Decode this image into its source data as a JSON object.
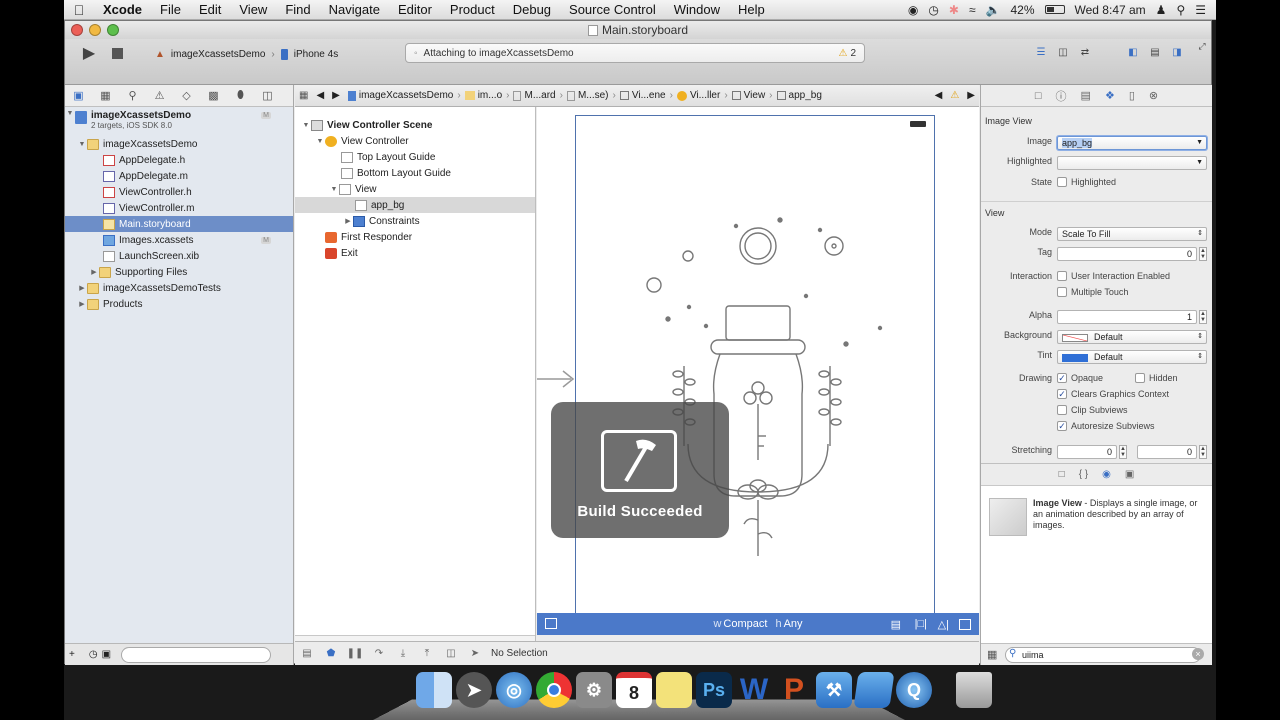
{
  "menubar": {
    "items": [
      "Xcode",
      "File",
      "Edit",
      "View",
      "Find",
      "Navigate",
      "Editor",
      "Product",
      "Debug",
      "Source Control",
      "Window",
      "Help"
    ],
    "battery": "42%",
    "clock": "Wed 8:47 am"
  },
  "window": {
    "title": "Main.storyboard",
    "scheme_target": "imageXcassetsDemo",
    "scheme_device": "iPhone 4s",
    "activity_text": "Attaching to imageXcassetsDemo",
    "warning_count": "2"
  },
  "navigator": {
    "project_name": "imageXcassetsDemo",
    "project_sub": "2 targets, iOS SDK 8.0",
    "badge": "M",
    "group": "imageXcassetsDemo",
    "files": [
      {
        "name": "AppDelegate.h"
      },
      {
        "name": "AppDelegate.m"
      },
      {
        "name": "ViewController.h"
      },
      {
        "name": "ViewController.m"
      },
      {
        "name": "Main.storyboard"
      },
      {
        "name": "Images.xcassets"
      },
      {
        "name": "LaunchScreen.xib"
      },
      {
        "name": "Supporting Files"
      }
    ],
    "tests_group": "imageXcassetsDemoTests",
    "products_group": "Products"
  },
  "jumpbar": {
    "segments": [
      "imageXcassetsDemo",
      "im...o",
      "M...ard",
      "M...se)",
      "Vi...ene",
      "Vi...ller",
      "View",
      "app_bg"
    ]
  },
  "outline": {
    "scene": "View Controller Scene",
    "controller": "View Controller",
    "top_guide": "Top Layout Guide",
    "bottom_guide": "Bottom Layout Guide",
    "view": "View",
    "image": "app_bg",
    "constraints": "Constraints",
    "first_responder": "First Responder",
    "exit": "Exit"
  },
  "canvas": {
    "size_width": "Compact",
    "size_height": "Any",
    "hud_label": "Build Succeeded",
    "selection": "No Selection"
  },
  "inspector": {
    "image_section": "Image View",
    "image_label": "Image",
    "image_value": "app_bg",
    "highlighted_label": "Highlighted",
    "state_label": "State",
    "state_option": "Highlighted",
    "view_section": "View",
    "mode_label": "Mode",
    "mode_value": "Scale To Fill",
    "tag_label": "Tag",
    "tag_value": "0",
    "interaction_label": "Interaction",
    "user_interaction": "User Interaction Enabled",
    "multiple_touch": "Multiple Touch",
    "alpha_label": "Alpha",
    "alpha_value": "1",
    "background_label": "Background",
    "background_value": "Default",
    "tint_label": "Tint",
    "tint_value": "Default",
    "drawing_label": "Drawing",
    "opaque": "Opaque",
    "hidden": "Hidden",
    "clears_context": "Clears Graphics Context",
    "clip_subviews": "Clip Subviews",
    "autoresize": "Autoresize Subviews",
    "stretching_label": "Stretching",
    "stretch_x": "0",
    "stretch_y": "0"
  },
  "library": {
    "item_title": "Image View",
    "item_desc": " - Displays a single image, or an animation described by an array of images.",
    "filter_value": "uiima"
  },
  "colors": {
    "accent": "#4b79c9",
    "selection": "#6d8ec8"
  }
}
